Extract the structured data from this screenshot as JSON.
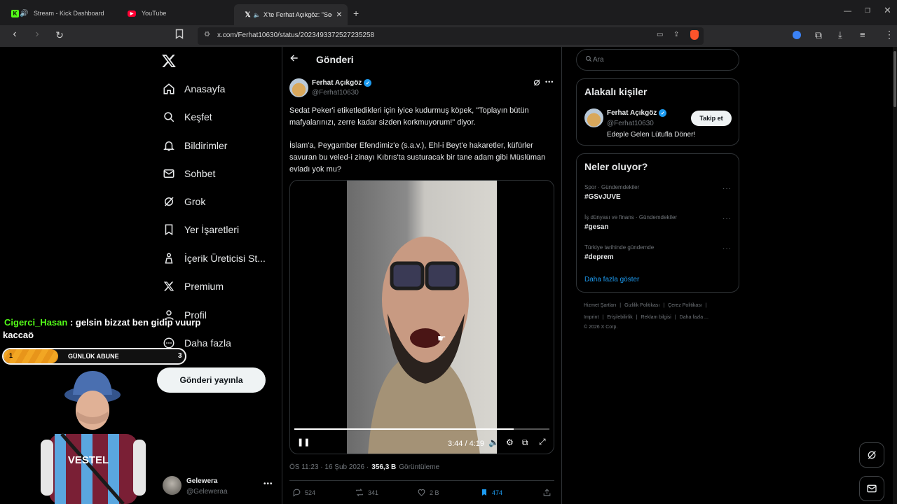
{
  "browser": {
    "tabs": [
      {
        "title": "Stream - Kick Dashboard",
        "icon": "kick-icon"
      },
      {
        "title": "YouTube",
        "icon": "youtube-icon"
      },
      {
        "title": "X'te Ferhat Açıkgöz: \"Sedat",
        "icon": "x-logo-icon"
      }
    ],
    "new_tab": "+",
    "url": "x.com/Ferhat10630/status/2023493372527235258"
  },
  "sidebar": {
    "items": [
      {
        "label": "Anasayfa"
      },
      {
        "label": "Keşfet"
      },
      {
        "label": "Bildirimler"
      },
      {
        "label": "Sohbet"
      },
      {
        "label": "Grok"
      },
      {
        "label": "Yer İşaretleri"
      },
      {
        "label": "İçerik Üreticisi St..."
      },
      {
        "label": "Premium"
      },
      {
        "label": "Profil"
      },
      {
        "label": "Daha fazla"
      }
    ],
    "post_button": "Gönderi yayınla",
    "account": {
      "name": "Gelewera",
      "handle": "@Geleweraa"
    }
  },
  "overlay": {
    "chat_user": "Cigerci_Hasan",
    "chat_message": ": gelsin bizzat ben gidip vuurp",
    "chat_message_2": "kaccaö",
    "goal_start": "1",
    "goal_label": "GÜNLÜK ABUNE",
    "goal_end": "3",
    "goal_progress": 0.3,
    "jersey_text": "VESTEL"
  },
  "post": {
    "header_title": "Gönderi",
    "author_name": "Ferhat Açıkgöz",
    "author_handle": "@Ferhat10630",
    "text_1": "Sedat Peker'i etiketledikleri için iyice kudurmuş köpek, \"Toplayın bütün mafyalarınızı, zerre kadar sizden korkmuyorum!\" diyor.",
    "text_2": "İslam'a, Peygamber Efendimiz'e (s.a.v.), Ehl-i Beyt'e hakaretler, küfürler savuran bu veled-i zinayı Kıbrıs'ta susturacak bir tane adam gibi Müslüman evladı yok mu?",
    "video": {
      "time": "3:44 / 4:19",
      "progress": 0.86
    },
    "timestamp": "ÖS 11:23 · 16 Şub 2026 ·",
    "views": "356,3 B",
    "views_label": "Görüntüleme",
    "replies": "524",
    "reposts": "341",
    "likes": "2 B",
    "bookmarks": "474"
  },
  "right": {
    "search_placeholder": "Ara",
    "related_title": "Alakalı kişiler",
    "related_name": "Ferhat Açıkgöz",
    "related_handle": "@Ferhat10630",
    "related_bio": "Edeple Gelen Lütufla Döner!",
    "follow_label": "Takip et",
    "trends_title": "Neler oluyor?",
    "trends": [
      {
        "category": "Spor · Gündemdekiler",
        "tag": "#GSvJUVE"
      },
      {
        "category": "İş dünyası ve finans · Gündemdekiler",
        "tag": "#gesan"
      },
      {
        "category": "Türkiye tarihinde gündemde",
        "tag": "#deprem"
      }
    ],
    "show_more": "Daha fazla göster",
    "footer_row1": [
      "Hizmet Şartları",
      "Gizlilik Politikası",
      "Çerez Politikası"
    ],
    "footer_row2": [
      "Imprint",
      "Erişilebilirlik",
      "Reklam bilgisi",
      "Daha fazla ..."
    ],
    "copyright": "© 2026 X Corp."
  },
  "colors": {
    "accent": "#1d9bf0",
    "kick": "#53fc18",
    "youtube": "#ff0033",
    "goal_bar": "#f2a623"
  }
}
